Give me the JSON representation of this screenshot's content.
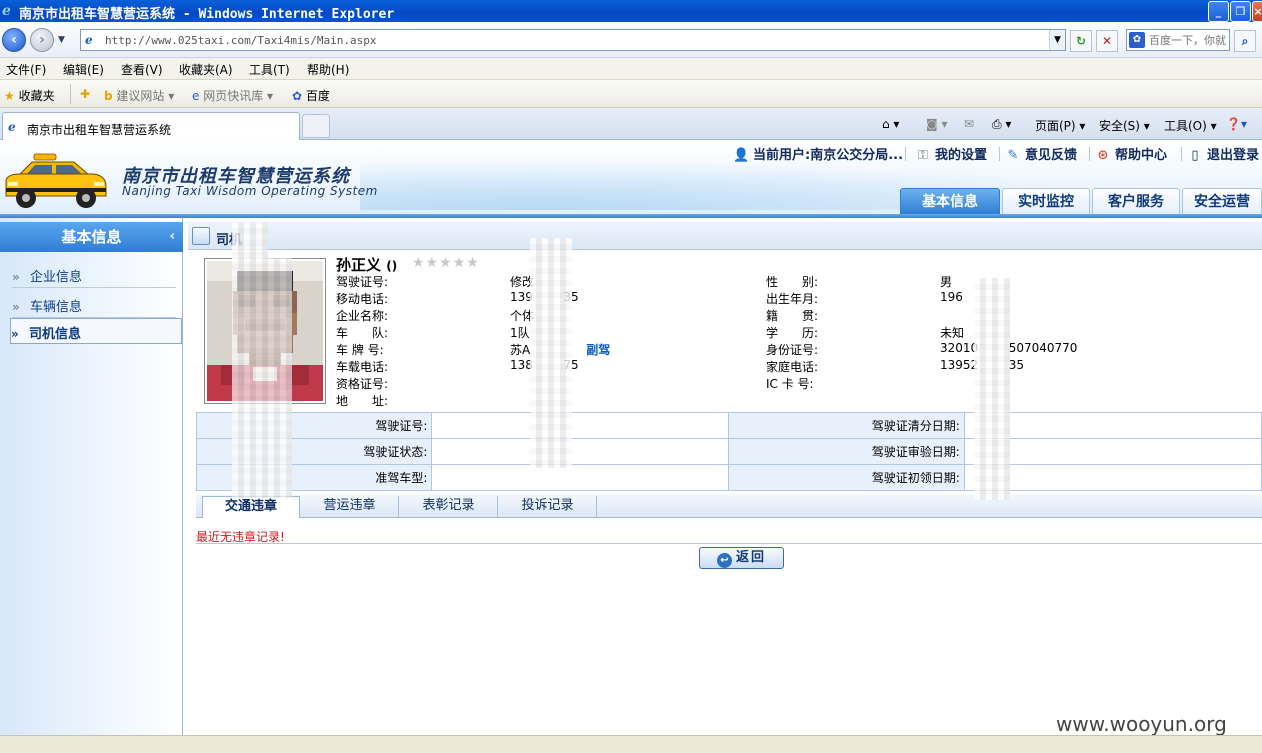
{
  "window": {
    "title": "南京市出租车智慧营运系统 - Windows Internet Explorer"
  },
  "browser": {
    "url": "http://www.025taxi.com/Taxi4mis/Main.aspx",
    "search_placeholder": "百度一下，你就",
    "menu": [
      "文件(F)",
      "编辑(E)",
      "查看(V)",
      "收藏夹(A)",
      "工具(T)",
      "帮助(H)"
    ],
    "favorites": {
      "label": "收藏夹",
      "suggested": "建议网站",
      "webslice": "网页快讯库",
      "baidu": "百度"
    },
    "tab_title": "南京市出租车智慧营运系统",
    "commands": {
      "page": "页面(P)",
      "safety": "安全(S)",
      "tools": "工具(O)"
    }
  },
  "app": {
    "brand_zh": "南京市出租车智慧营运系统",
    "brand_en": "Nanjing Taxi Wisdom Operating System",
    "top_links": {
      "current_user": "当前用户:南京公交分局...",
      "my_settings": "我的设置",
      "feedback": "意见反馈",
      "help": "帮助中心",
      "logout": "退出登录"
    },
    "nav_tabs": [
      "基本信息",
      "实时监控",
      "客户服务",
      "安全运营"
    ]
  },
  "sidebar": {
    "title": "基本信息",
    "items": [
      "企业信息",
      "车辆信息",
      "司机信息"
    ]
  },
  "breadcrumb": "司机",
  "driver": {
    "name": "孙正义",
    "name_suffix": "()",
    "rating_stars": "★★★★★",
    "left": [
      {
        "label": "驾驶证号:",
        "value": "修改"
      },
      {
        "label": "移动电话:",
        "value": "139        35"
      },
      {
        "label": "企业名称:",
        "value": "个体"
      },
      {
        "label": "车　　队:",
        "value": "1队"
      },
      {
        "label": "车 牌 号:",
        "value": "苏A",
        "link": "副驾"
      },
      {
        "label": "车载电话:",
        "value": "138        75"
      },
      {
        "label": "资格证号:",
        "value": ""
      },
      {
        "label": "地　　址:",
        "value": ""
      }
    ],
    "right": [
      {
        "label": "性　　别:",
        "value": "男"
      },
      {
        "label": "出生年月:",
        "value": "196"
      },
      {
        "label": "籍　　贯:",
        "value": ""
      },
      {
        "label": "学　　历:",
        "value": "未知"
      },
      {
        "label": "身份证号:",
        "value": "32010        507040770"
      },
      {
        "label": "家庭电话:",
        "value": "13952        35"
      },
      {
        "label": "IC 卡 号:",
        "value": ""
      }
    ]
  },
  "license_table": [
    {
      "left_label": "驾驶证号:",
      "left_value": "",
      "right_label": "驾驶证清分日期:",
      "right_value": ""
    },
    {
      "left_label": "驾驶证状态:",
      "left_value": "",
      "right_label": "驾驶证审验日期:",
      "right_value": ""
    },
    {
      "left_label": "准驾车型:",
      "left_value": "",
      "right_label": "驾驶证初领日期:",
      "right_value": ""
    }
  ],
  "sub_tabs": [
    "交通违章",
    "营运违章",
    "表彰记录",
    "投诉记录"
  ],
  "notice": "最近无违章记录!",
  "back_button": "返回",
  "watermark": "www.wooyun.org",
  "colors": {
    "accent": "#2f7fd6",
    "notice": "#cc1b1b",
    "title_bar": "#0549c4"
  }
}
